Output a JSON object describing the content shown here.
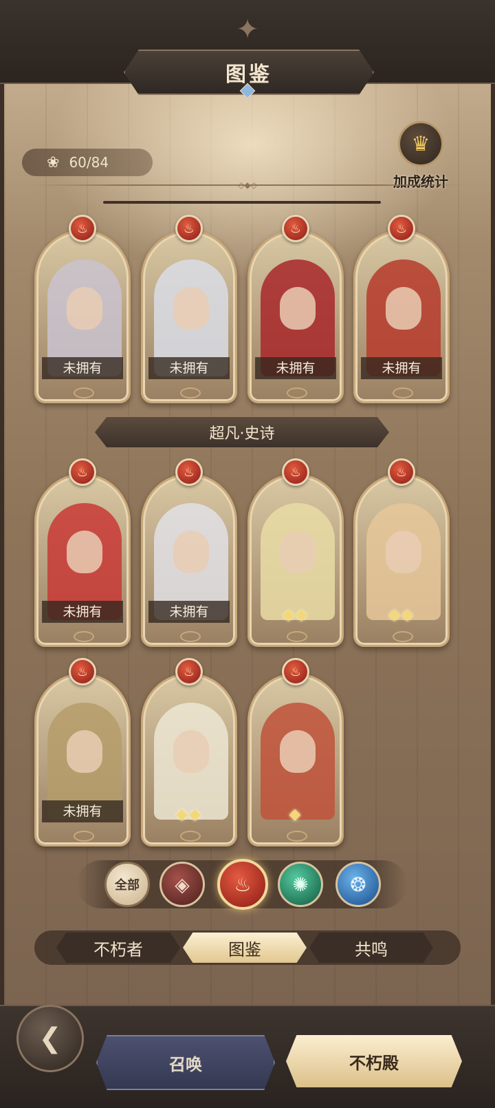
{
  "header": {
    "title": "图鉴"
  },
  "collection": {
    "count_text": "60/84"
  },
  "bonus": {
    "label": "加成统计",
    "icon": "figure-icon"
  },
  "rows": [
    {
      "cards": [
        {
          "status": "未拥有",
          "owned": false,
          "stars": "",
          "hair": "#c9c3cf"
        },
        {
          "status": "未拥有",
          "owned": false,
          "stars": "",
          "hair": "#d9dde6"
        },
        {
          "status": "未拥有",
          "owned": false,
          "stars": "",
          "hair": "#a8282a"
        },
        {
          "status": "未拥有",
          "owned": false,
          "stars": "",
          "hair": "#b63b2c"
        }
      ]
    }
  ],
  "section": {
    "label": "超凡·史诗"
  },
  "epic_cards": [
    {
      "status": "未拥有",
      "owned": false,
      "stars": "",
      "hair": "#c83a36"
    },
    {
      "status": "未拥有",
      "owned": false,
      "stars": "",
      "hair": "#e2e0e6"
    },
    {
      "status": "",
      "owned": true,
      "stars": "◆◆",
      "hair": "#e9dca5"
    },
    {
      "status": "",
      "owned": true,
      "stars": "◆◆",
      "hair": "#e6c79a"
    },
    {
      "status": "未拥有",
      "owned": false,
      "stars": "",
      "hair": "#b59c6a"
    },
    {
      "status": "",
      "owned": true,
      "stars": "◆◆",
      "hair": "#ece6d2"
    },
    {
      "status": "",
      "owned": true,
      "stars": "◆",
      "hair": "#c0523a"
    }
  ],
  "filters": {
    "all_label": "全部",
    "items": [
      "void-element-icon",
      "fire-element-icon",
      "wind-element-icon",
      "water-element-icon"
    ],
    "selected": "fire-element-icon"
  },
  "tabs": {
    "immortal": "不朽者",
    "codex": "图鉴",
    "resonance": "共鸣",
    "active": "图鉴"
  },
  "nav": {
    "summon": "召唤",
    "hall": "不朽殿"
  },
  "colors": {
    "fire": "#c23424",
    "wind": "#1f8e63",
    "water": "#2c78c6",
    "gold": "#d8bf8f"
  }
}
